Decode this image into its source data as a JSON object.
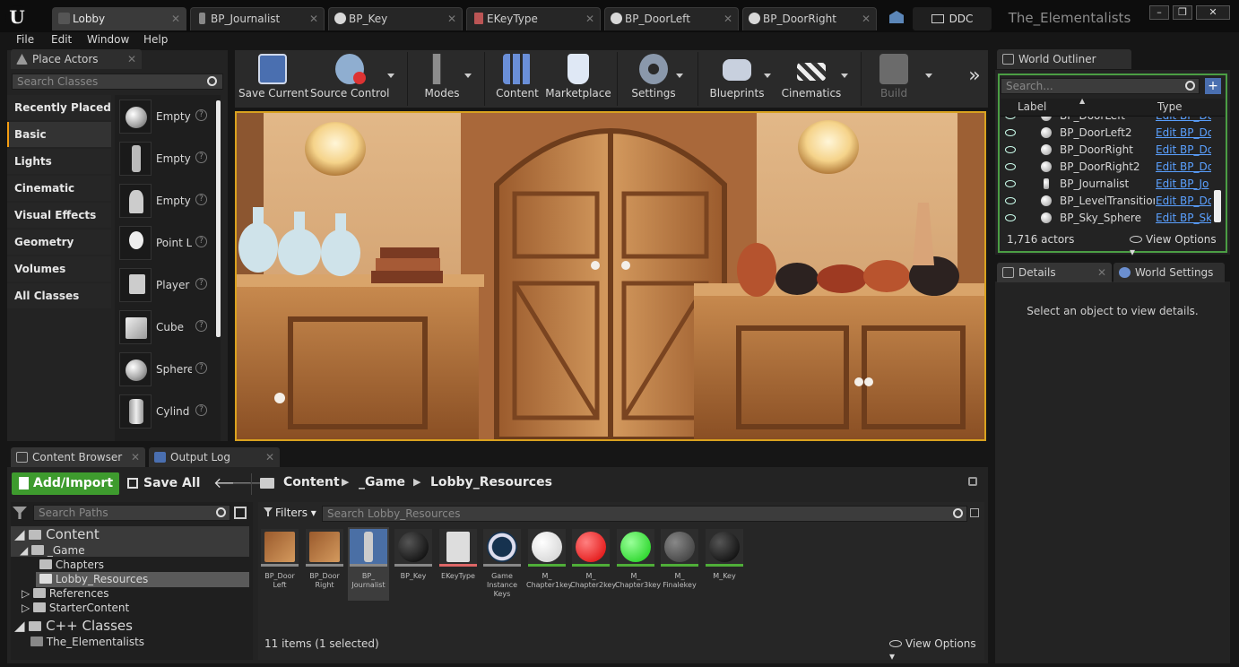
{
  "window": {
    "tabs": [
      {
        "label": "Lobby",
        "icon": "level-icon"
      },
      {
        "label": "BP_Journalist",
        "icon": "blueprint-icon"
      },
      {
        "label": "BP_Key",
        "icon": "blueprint-icon"
      },
      {
        "label": "EKeyType",
        "icon": "enum-icon"
      },
      {
        "label": "BP_DoorLeft",
        "icon": "blueprint-icon"
      },
      {
        "label": "BP_DoorRight",
        "icon": "blueprint-icon"
      }
    ],
    "ddc": "DDC",
    "project_name": "The_Elementalists"
  },
  "menu": [
    "File",
    "Edit",
    "Window",
    "Help"
  ],
  "place_actors": {
    "tab": "Place Actors",
    "search_placeholder": "Search Classes",
    "categories": [
      "Recently Placed",
      "Basic",
      "Lights",
      "Cinematic",
      "Visual Effects",
      "Geometry",
      "Volumes",
      "All Classes"
    ],
    "selected_category": "Basic",
    "items": [
      "Empty",
      "Empty",
      "Empty",
      "Point L",
      "Player",
      "Cube",
      "Sphere",
      "Cylind"
    ]
  },
  "toolbar": {
    "buttons": [
      "Save Current",
      "Source Control",
      "Modes",
      "Content",
      "Marketplace",
      "Settings",
      "Blueprints",
      "Cinematics",
      "Build"
    ],
    "more": "»"
  },
  "outliner": {
    "tab": "World Outliner",
    "search_placeholder": "Search...",
    "col_label": "Label",
    "col_type": "Type",
    "rows": [
      {
        "label": "BP_DoorLeft",
        "type": "Edit BP_Do"
      },
      {
        "label": "BP_DoorLeft2",
        "type": "Edit BP_Do"
      },
      {
        "label": "BP_DoorRight",
        "type": "Edit BP_Do"
      },
      {
        "label": "BP_DoorRight2",
        "type": "Edit BP_Do"
      },
      {
        "label": "BP_Journalist",
        "type": "Edit BP_Jo"
      },
      {
        "label": "BP_LevelTransition",
        "type": "Edit BP_Do"
      },
      {
        "label": "BP_Sky_Sphere",
        "type": "Edit BP_Sk"
      }
    ],
    "count": "1,716 actors",
    "view_options": "View Options"
  },
  "details": {
    "tab": "Details",
    "tab2": "World Settings",
    "empty_text": "Select an object to view details."
  },
  "bottom_tabs": {
    "content_browser": "Content Browser",
    "output_log": "Output Log"
  },
  "content_browser": {
    "add_import": "Add/Import",
    "save_all": "Save All",
    "breadcrumb": [
      "Content",
      "_Game",
      "Lobby_Resources"
    ],
    "search_paths": "Search Paths",
    "filters": "Filters",
    "search_assets": "Search Lobby_Resources",
    "tree": {
      "content": "Content",
      "game": "_Game",
      "chapters": "Chapters",
      "lobby_resources": "Lobby_Resources",
      "references": "References",
      "starter": "StarterContent",
      "cpp": "C++ Classes",
      "project": "The_Elementalists"
    },
    "assets": [
      {
        "name": "BP_Door Left",
        "color": "#888888",
        "line": "#3b7bd1"
      },
      {
        "name": "BP_Door Right",
        "color": "#888888",
        "line": "#3b7bd1"
      },
      {
        "name": "BP_ Journalist",
        "color": "#888888",
        "line": "#3b7bd1"
      },
      {
        "name": "BP_Key",
        "color": "#0a0a0a",
        "line": "#3b7bd1"
      },
      {
        "name": "EKeyType",
        "color": "#dddddd",
        "line": "#d66"
      },
      {
        "name": "Game Instance Keys",
        "color": "#16324f",
        "line": "#3b7bd1"
      },
      {
        "name": "M_ Chapter1key",
        "color": "#f2f2f2",
        "line": "#4fae38"
      },
      {
        "name": "M_ Chapter2key",
        "color": "#e01010",
        "line": "#4fae38"
      },
      {
        "name": "M_ Chapter3key",
        "color": "#23d023",
        "line": "#4fae38"
      },
      {
        "name": "M_ Finalekey",
        "color": "#4a4a4a",
        "line": "#4fae38"
      },
      {
        "name": "M_Key",
        "color": "#0a0a0a",
        "line": "#4fae38"
      }
    ],
    "status": "11 items (1 selected)",
    "view_options": "View Options"
  },
  "colors": {
    "accent": "#f39c12",
    "add_import": "#3e9b2e",
    "link": "#5aa0ff"
  }
}
